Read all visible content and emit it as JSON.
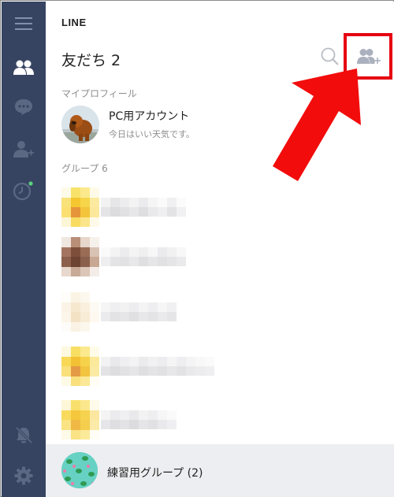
{
  "app": {
    "name": "LINE"
  },
  "header": {
    "title": "友だち 2"
  },
  "profile": {
    "section_label": "マイプロフィール",
    "name": "PC用アカウント",
    "status": "今日はいい天気です。"
  },
  "groups": {
    "section_label": "グループ 6"
  },
  "bottom": {
    "group_name": "練習用グループ (2)"
  },
  "icons": {
    "sidebar": [
      "menu-icon",
      "friends-icon",
      "chat-icon",
      "add-friend-icon",
      "timeline-icon",
      "notification-off-icon",
      "settings-icon"
    ],
    "header": [
      "search-icon",
      "add-friend-icon"
    ]
  },
  "colors": {
    "sidebar_bg": "#374461",
    "sidebar_icon": "#8390ad",
    "sidebar_active": "#ffffff",
    "highlight": "#e60012",
    "online_dot": "#5ad17e",
    "bottom_bar_bg": "#edeef1"
  }
}
